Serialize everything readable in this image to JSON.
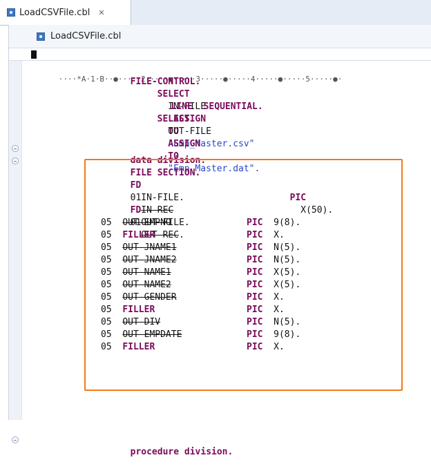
{
  "tab": {
    "file_name": "LoadCSVFile.cbl",
    "close_glyph": "✕"
  },
  "editor": {
    "file_header": "LoadCSVFile.cbl",
    "ruler": "····*A·1·B··●·····2·····●·····3·····●·····4·····●·····5·····●·"
  },
  "code": {
    "file_control": "FILE-CONTROL.",
    "select1_kw": "SELECT",
    "select1_name": "IN-FILE",
    "assign1_kw": "ASSIGN",
    "to1_kw": "TO",
    "select1_value": "\"Emp_Master.csv\"",
    "line_seq": "LINE  SEQUENTIAL.",
    "select2_kw": "SELECT",
    "select2_name": "OUT-FILE",
    "assign2_kw": "ASSIGN",
    "to2_kw": "TO",
    "select2_value": "\"Emp_Master.dat\".",
    "data_div": "data division.",
    "file_section": "FILE SECTION.",
    "fd1": "FD",
    "fd1_name": "IN-FILE.",
    "lvl01_1": "01",
    "in_rec": "IN-REC",
    "pic1": "PIC",
    "pic1_v": "X(50).",
    "fd2": "FD",
    "fd2_name": "OUT-FILE.",
    "lvl01_2": "01",
    "out_rec": "OUT-REC",
    "out_rec_dot": ".",
    "items": [
      {
        "lvl": "05",
        "name": "OUT-EMPNO",
        "struck": true,
        "pic": "PIC",
        "val": "9(8)."
      },
      {
        "lvl": "05",
        "name": "FILLER",
        "struck": false,
        "pic": "PIC",
        "val": "X."
      },
      {
        "lvl": "05",
        "name": "OUT-JNAME1",
        "struck": true,
        "pic": "PIC",
        "val": "N(5)."
      },
      {
        "lvl": "05",
        "name": "OUT-JNAME2",
        "struck": true,
        "pic": "PIC",
        "val": "N(5)."
      },
      {
        "lvl": "05",
        "name": "OUT-NAME1",
        "struck": true,
        "pic": "PIC",
        "val": "X(5)."
      },
      {
        "lvl": "05",
        "name": "OUT-NAME2",
        "struck": true,
        "pic": "PIC",
        "val": "X(5)."
      },
      {
        "lvl": "05",
        "name": "OUT-GENDER",
        "struck": true,
        "pic": "PIC",
        "val": "X."
      },
      {
        "lvl": "05",
        "name": "FILLER",
        "struck": false,
        "pic": "PIC",
        "val": "X."
      },
      {
        "lvl": "05",
        "name": "OUT-DIV",
        "struck": true,
        "pic": "PIC",
        "val": "N(5)."
      },
      {
        "lvl": "05",
        "name": "OUT-EMPDATE",
        "struck": true,
        "pic": "PIC",
        "val": "9(8)."
      },
      {
        "lvl": "05",
        "name": "FILLER",
        "struck": false,
        "pic": "PIC",
        "val": "X."
      }
    ],
    "proc_div": "procedure division."
  },
  "colors": {
    "keyword": "#7a0a5a",
    "string": "#2a46c8",
    "highlight_box": "#f07b18"
  }
}
